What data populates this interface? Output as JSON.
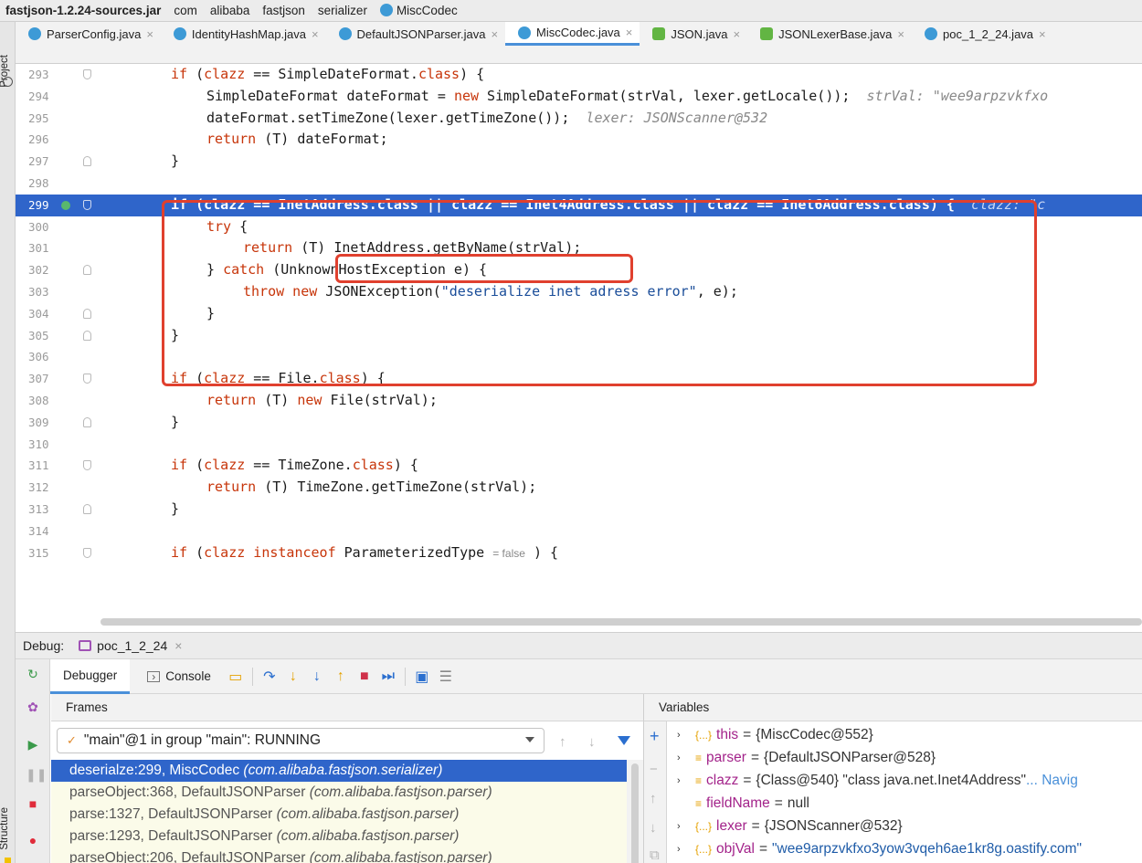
{
  "breadcrumb": [
    "fastjson-1.2.24-sources.jar",
    "com",
    "alibaba",
    "fastjson",
    "serializer",
    "MiscCodec"
  ],
  "side_tabs": {
    "project": "Project",
    "structure": "Structure"
  },
  "tabs": [
    {
      "label": "ParserConfig.java",
      "icon": "java-class-icon",
      "color": "#3d9ad6"
    },
    {
      "label": "IdentityHashMap.java",
      "icon": "java-class-icon",
      "color": "#3d9ad6"
    },
    {
      "label": "DefaultJSONParser.java",
      "icon": "java-class-icon",
      "color": "#3d9ad6"
    },
    {
      "label": "MiscCodec.java",
      "icon": "java-class-icon",
      "color": "#3d9ad6",
      "active": true
    },
    {
      "label": "JSON.java",
      "icon": "java-abstract-icon",
      "color": "#62b543"
    },
    {
      "label": "JSONLexerBase.java",
      "icon": "java-abstract-icon",
      "color": "#62b543"
    },
    {
      "label": "poc_1_2_24.java",
      "icon": "java-class-icon",
      "color": "#3d9ad6"
    }
  ],
  "code": {
    "highlight_line": 299,
    "line_numbers": [
      "293",
      "294",
      "295",
      "296",
      "297",
      "298",
      "299",
      "300",
      "301",
      "302",
      "303",
      "304",
      "305",
      "306",
      "307",
      "308",
      "309",
      "310",
      "311",
      "312",
      "313",
      "314",
      "315"
    ],
    "hints": {
      "l294": "strVal: \"wee9arpzvkfxo",
      "l295": "lexer: JSONScanner@532",
      "l299": "clazz: \"c",
      "l315": "= false"
    },
    "strings": {
      "l303": "\"deserialize inet adress error\""
    }
  },
  "debug": {
    "label": "Debug:",
    "session": "poc_1_2_24",
    "tabs": {
      "debugger": "Debugger",
      "console": "Console"
    },
    "frames_title": "Frames",
    "variables_title": "Variables",
    "thread": "\"main\"@1 in group \"main\": RUNNING",
    "frames": [
      {
        "method": "deserialze:299, MiscCodec",
        "pkg": "(com.alibaba.fastjson.serializer)",
        "selected": true
      },
      {
        "method": "parseObject:368, DefaultJSONParser",
        "pkg": "(com.alibaba.fastjson.parser)"
      },
      {
        "method": "parse:1327, DefaultJSONParser",
        "pkg": "(com.alibaba.fastjson.parser)"
      },
      {
        "method": "parse:1293, DefaultJSONParser",
        "pkg": "(com.alibaba.fastjson.parser)"
      },
      {
        "method": "parseObject:206, DefaultJSONParser",
        "pkg": "(com.alibaba.fastjson.parser)"
      }
    ],
    "variables": [
      {
        "expand": "›",
        "icon": "{...}",
        "name": "this",
        "value": "{MiscCodec@552}",
        "str": "",
        "nav": ""
      },
      {
        "expand": "›",
        "icon": "≡",
        "name": "parser",
        "value": "{DefaultJSONParser@528}",
        "str": "",
        "nav": ""
      },
      {
        "expand": "›",
        "icon": "≡",
        "name": "clazz",
        "value": "{Class@540} \"class java.net.Inet4Address\"",
        "str": "",
        "nav": "... Navig"
      },
      {
        "expand": "",
        "icon": "≡",
        "name": "fieldName",
        "value": "null",
        "str": "",
        "nav": ""
      },
      {
        "expand": "›",
        "icon": "{...}",
        "name": "lexer",
        "value": "{JSONScanner@532}",
        "str": "",
        "nav": ""
      },
      {
        "expand": "›",
        "icon": "{...}",
        "name": "objVal",
        "value": "",
        "str": "\"wee9arpzvkfxo3yow3vqeh6ae1kr8g.oastify.com\"",
        "nav": ""
      }
    ]
  }
}
